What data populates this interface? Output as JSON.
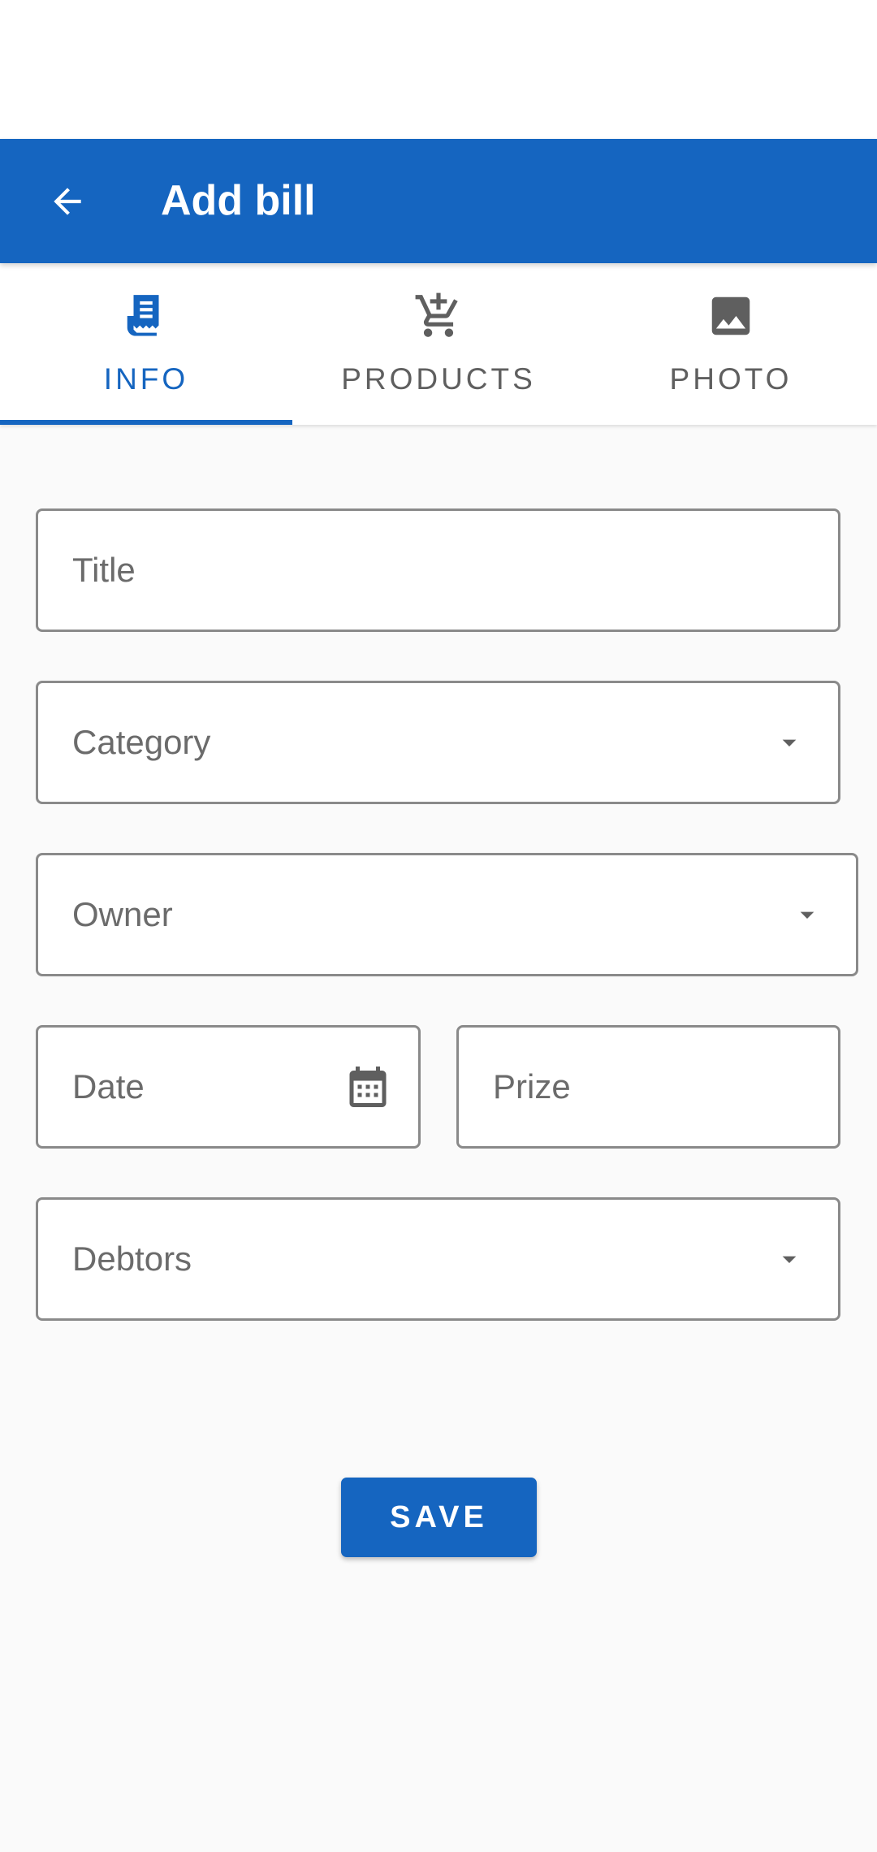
{
  "app_bar": {
    "title": "Add bill",
    "back_icon": "arrow-back-icon",
    "background": "#1565c0"
  },
  "tabs": [
    {
      "label": "INFO",
      "icon": "receipt-icon",
      "active": true
    },
    {
      "label": "PRODUCTS",
      "icon": "add-shopping-cart-icon",
      "active": false
    },
    {
      "label": "PHOTO",
      "icon": "image-icon",
      "active": false
    }
  ],
  "form": {
    "title": {
      "placeholder": "Title",
      "value": ""
    },
    "category": {
      "placeholder": "Category",
      "value": "",
      "icon": "dropdown-arrow-icon"
    },
    "owner": {
      "placeholder": "Owner",
      "value": "",
      "icon": "dropdown-arrow-icon"
    },
    "date": {
      "placeholder": "Date",
      "value": "",
      "icon": "calendar-icon"
    },
    "prize": {
      "placeholder": "Prize",
      "value": ""
    },
    "debtors": {
      "placeholder": "Debtors",
      "value": "",
      "icon": "dropdown-arrow-icon"
    }
  },
  "actions": {
    "save_label": "SAVE"
  },
  "colors": {
    "accent": "#1565c0",
    "inactive_tab": "#5f5f5f",
    "field_border": "#8a8a8a"
  }
}
